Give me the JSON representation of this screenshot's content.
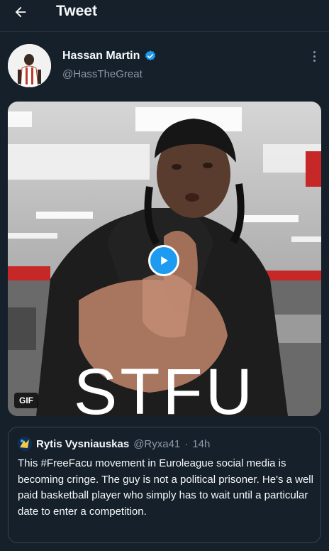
{
  "header": {
    "title": "Tweet",
    "back_icon": "arrow-left-icon"
  },
  "tweet": {
    "author": {
      "display_name": "Hassan Martin",
      "handle": "@HassTheGreat",
      "verified": true,
      "verified_color": "#1d9bf0"
    },
    "media": {
      "type": "gif",
      "badge": "GIF",
      "caption_text": "STFU",
      "play_icon": "play-icon"
    },
    "quoted": {
      "display_name": "Rytis Vysniauskas",
      "handle": "@Ryxa41",
      "separator": "·",
      "time": "14h",
      "text": "This #FreeFacu movement in Euroleague social media is becoming cringe. The guy is not a political prisoner. He's a well paid basketball player who simply has to wait until a particular date to enter a competition."
    }
  },
  "colors": {
    "background": "#15202b",
    "accent": "#1d9bf0",
    "secondary_text": "#8b98a5",
    "border": "#38444d"
  }
}
